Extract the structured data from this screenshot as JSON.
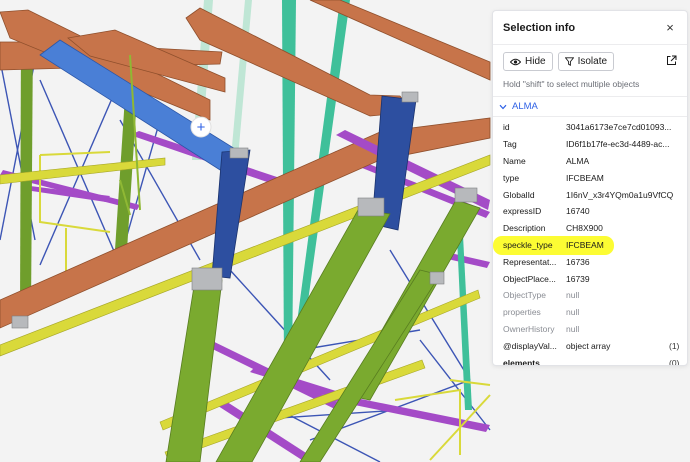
{
  "panel": {
    "title": "Selection info",
    "close_glyph": "×",
    "hide_label": "Hide",
    "isolate_label": "Isolate",
    "hint": "Hold \"shift\" to select multiple objects",
    "group_label": "ALMA",
    "rows": [
      {
        "key": "id",
        "value": "3041a6173e7ce7cd01093..."
      },
      {
        "key": "Tag",
        "value": "ID6f1b17fe-ec3d-4489-ac..."
      },
      {
        "key": "Name",
        "value": "ALMA"
      },
      {
        "key": "type",
        "value": "IFCBEAM"
      },
      {
        "key": "GlobalId",
        "value": "1I6nV_x3r4YQm0a1u9VfCQ"
      },
      {
        "key": "expressID",
        "value": "16740"
      },
      {
        "key": "Description",
        "value": "CH8X900"
      },
      {
        "key": "speckle_type",
        "value": "IFCBEAM"
      },
      {
        "key": "Representat...",
        "value": "16736"
      },
      {
        "key": "ObjectPlace...",
        "value": "16739"
      },
      {
        "key": "ObjectType",
        "value": "null"
      },
      {
        "key": "properties",
        "value": "null"
      },
      {
        "key": "OwnerHistory",
        "value": "null"
      },
      {
        "key": "@displayVal...",
        "value": "object array",
        "count": "(1)"
      },
      {
        "key": "elements",
        "value": "",
        "count": "(0)"
      }
    ]
  },
  "viewport": {
    "cursor_glyph": "+"
  },
  "colors": {
    "accent": "#2f62e6",
    "highlight": "#fcfc33",
    "beam_orange": "#c7744a",
    "beam_blue": "#2d4fa0",
    "beam_green": "#6f9e2c",
    "beam_purple": "#a44bc7",
    "beam_teal": "#3fc09a",
    "beam_yellow": "#d9d93a",
    "bracing": "#3c55b5"
  },
  "icons": [
    "eye-icon",
    "filter-icon",
    "external-link-icon",
    "chevron-down-icon",
    "close-icon"
  ]
}
